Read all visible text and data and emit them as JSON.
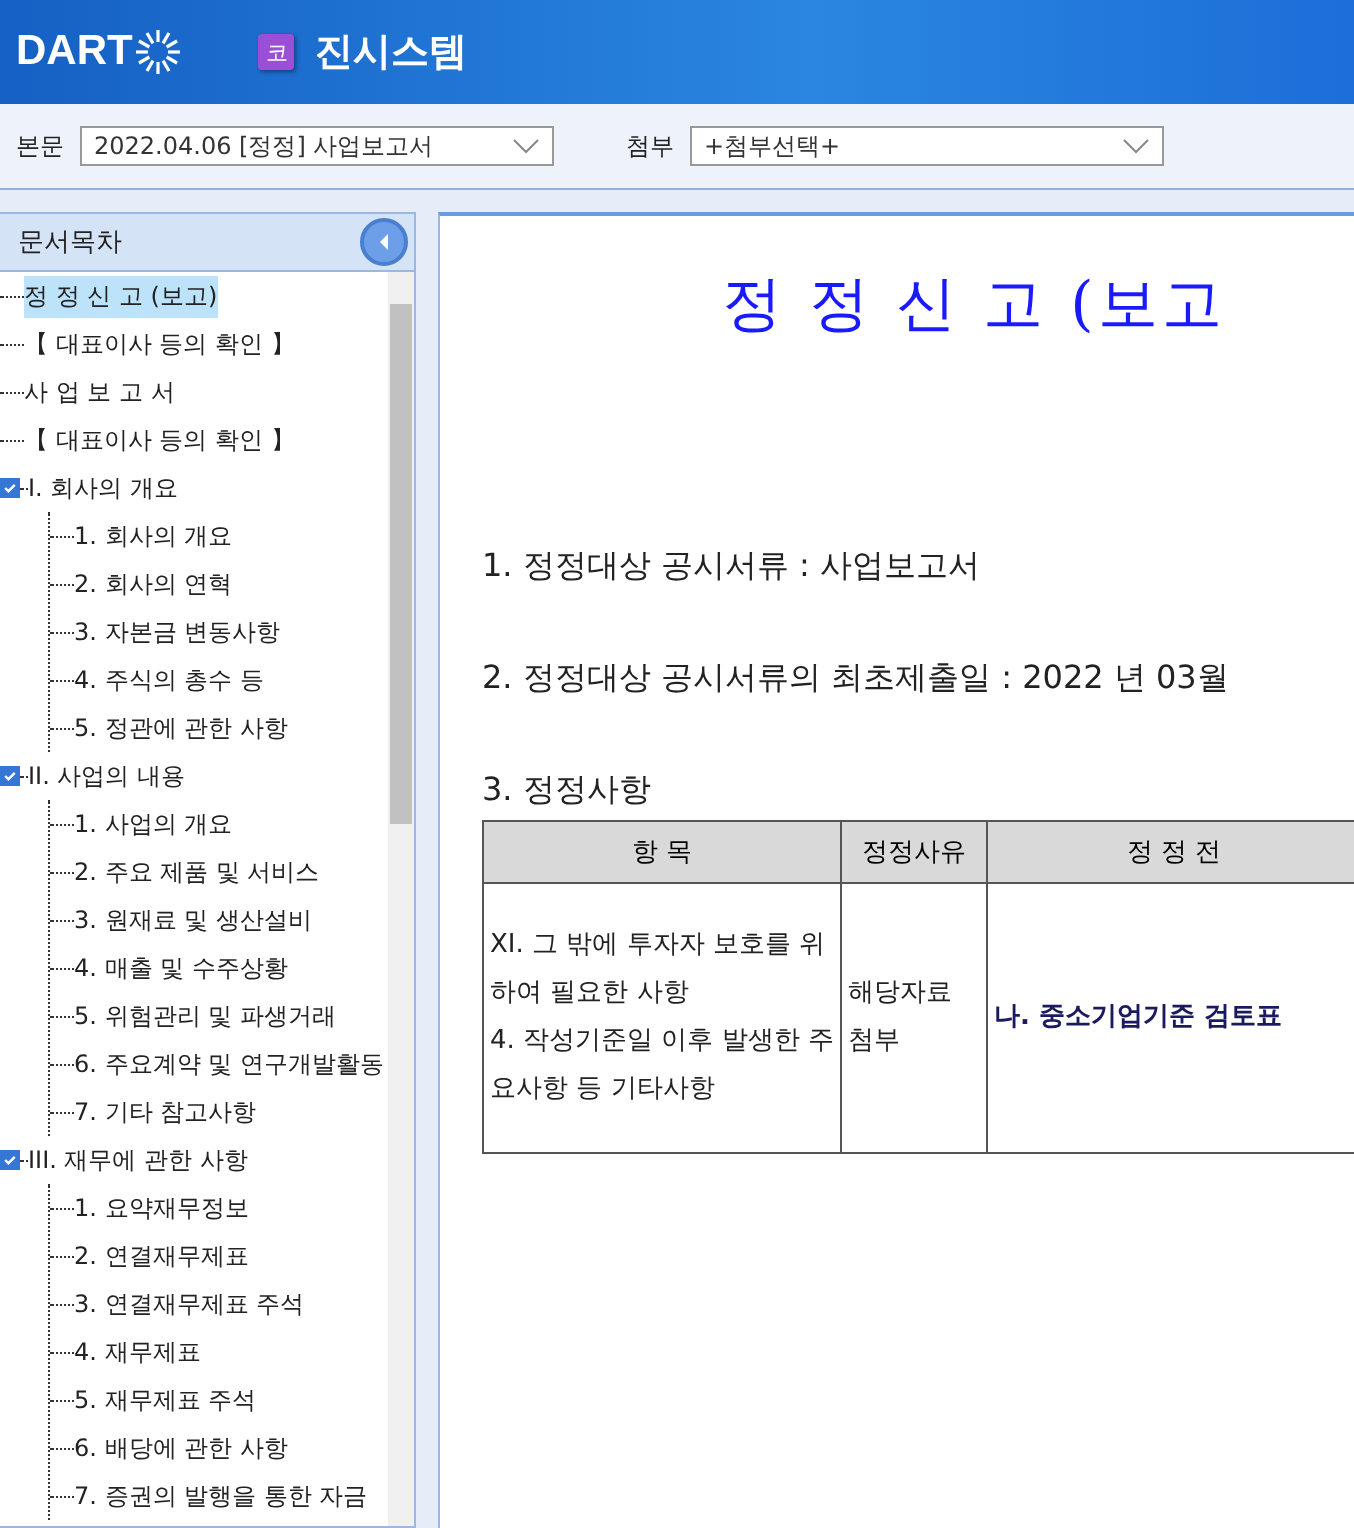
{
  "header": {
    "logo": "DART",
    "badge": "코",
    "title": "진시스템"
  },
  "toolbar": {
    "main_label": "본문",
    "main_value": "2022.04.06  [정정] 사업보고서",
    "attach_label": "첨부",
    "attach_value": "+첨부선택+"
  },
  "sidebar": {
    "title": "문서목차",
    "tree": [
      {
        "label": "정 정 신 고 (보고)",
        "selected": true
      },
      {
        "label": "【 대표이사 등의 확인 】",
        "selected": false
      },
      {
        "label": "사 업 보 고 서",
        "selected": false
      },
      {
        "label": "【 대표이사 등의 확인 】",
        "selected": false
      },
      {
        "label": "I. 회사의 개요",
        "selected": false,
        "expanded": true,
        "children": [
          {
            "label": "1. 회사의 개요",
            "selected": false
          },
          {
            "label": "2. 회사의 연혁",
            "selected": false
          },
          {
            "label": "3. 자본금 변동사항",
            "selected": false
          },
          {
            "label": "4. 주식의 총수 등",
            "selected": false
          },
          {
            "label": "5. 정관에 관한 사항",
            "selected": false
          }
        ]
      },
      {
        "label": "II. 사업의 내용",
        "selected": false,
        "expanded": true,
        "children": [
          {
            "label": "1. 사업의 개요",
            "selected": false
          },
          {
            "label": "2. 주요 제품 및 서비스",
            "selected": false
          },
          {
            "label": "3. 원재료 및 생산설비",
            "selected": false
          },
          {
            "label": "4. 매출 및 수주상황",
            "selected": false
          },
          {
            "label": "5. 위험관리 및 파생거래",
            "selected": false
          },
          {
            "label": "6. 주요계약 및 연구개발활동",
            "selected": false
          },
          {
            "label": "7. 기타 참고사항",
            "selected": false
          }
        ]
      },
      {
        "label": "III. 재무에 관한 사항",
        "selected": false,
        "expanded": true,
        "children": [
          {
            "label": "1. 요약재무정보",
            "selected": false
          },
          {
            "label": "2. 연결재무제표",
            "selected": false
          },
          {
            "label": "3. 연결재무제표 주석",
            "selected": false
          },
          {
            "label": "4. 재무제표",
            "selected": false
          },
          {
            "label": "5. 재무제표 주석",
            "selected": false
          },
          {
            "label": "6. 배당에 관한 사항",
            "selected": false
          },
          {
            "label": "7. 증권의 발행을 통한 자금",
            "selected": false
          }
        ]
      }
    ]
  },
  "document": {
    "title": "정 정 신 고 (보고",
    "items": [
      "1. 정정대상 공시서류 : 사업보고서",
      "2. 정정대상 공시서류의 최초제출일 : 2022 년  03월",
      "3. 정정사항"
    ],
    "table": {
      "columns": [
        "항 목",
        "정정사유",
        "정 정 전"
      ],
      "rows": [
        [
          "XI. 그 밖에 투자자 보호를 위하여 필요한 사항\n4. 작성기준일 이후 발생한 주요사항 등 기타사항",
          "해당자료 첨부",
          "나. 중소기업기준 검토표"
        ]
      ]
    }
  }
}
